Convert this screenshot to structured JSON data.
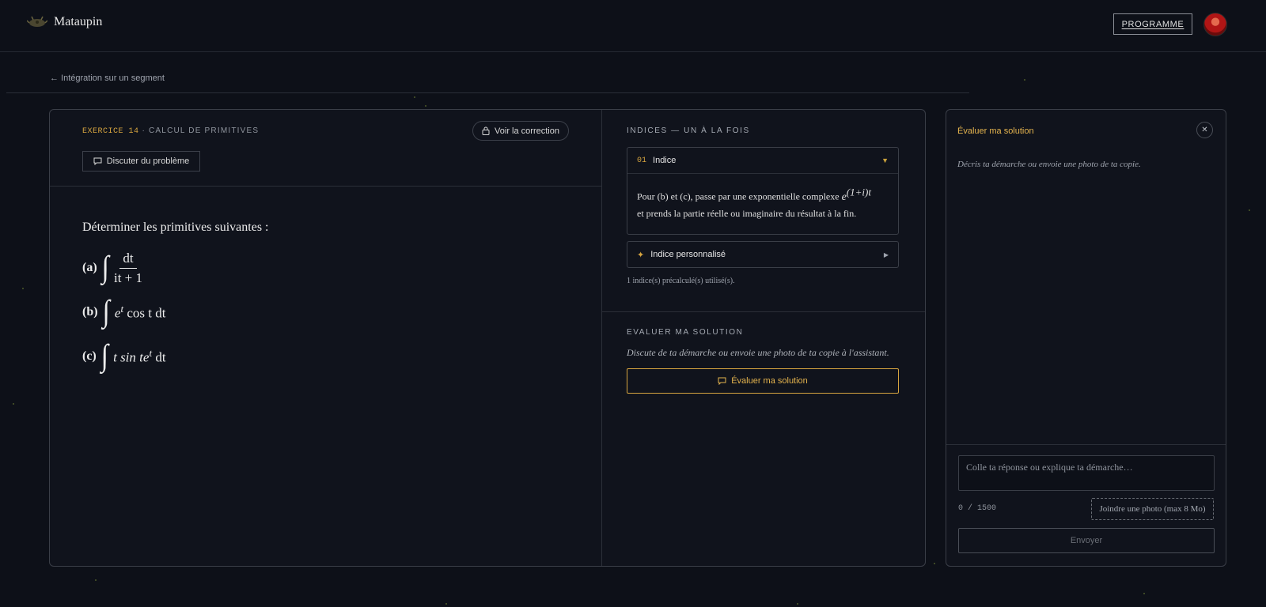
{
  "header": {
    "brand": "Mataupin",
    "programme_label": "PROGRAMME"
  },
  "breadcrumb": "← Intégration sur un segment",
  "exercise": {
    "label": "EXERCICE 14",
    "separator": " · ",
    "category": "CALCUL DE PRIMITIVES",
    "voir_correction": "Voir la correction",
    "discuter": "Discuter du problème",
    "intro": "Déterminer les primitives suivantes :",
    "items": [
      {
        "label": "(a)",
        "num": "dt",
        "den": "it + 1"
      },
      {
        "label": "(b)",
        "expr_base": "e",
        "expr_sup": "t",
        "expr_rest": "cos t dt"
      },
      {
        "label": "(c)",
        "expr_base": "t sin te",
        "expr_sup": "t",
        "expr_rest": "dt"
      }
    ]
  },
  "hints": {
    "title": "INDICES — UN À LA FOIS",
    "hint1_no": "01",
    "hint1_title": "Indice",
    "hint1_text_a": "Pour (b) et (c), passe par une exponentielle complexe ",
    "hint1_expo_base": "e",
    "hint1_expo_sup": "(1+i)t",
    "hint1_text_b": "et prends la partie réelle ou imaginaire du résultat à la fin.",
    "hint2_title": "Indice personnalisé",
    "note": "1 indice(s) précalculé(s) utilisé(s)."
  },
  "evaluate": {
    "title": "EVALUER MA SOLUTION",
    "description": "Discute de ta démarche ou envoie une photo de ta copie à l'assistant.",
    "button": "Évaluer ma solution"
  },
  "panel": {
    "title": "Évaluer ma solution",
    "hint": "Décris ta démarche ou envoie une photo de ta copie.",
    "placeholder": "Colle ta réponse ou explique ta démarche…",
    "counter": "0 / 1500",
    "photo_button": "Joindre une photo (max 8 Mo)",
    "send_button": "Envoyer"
  }
}
